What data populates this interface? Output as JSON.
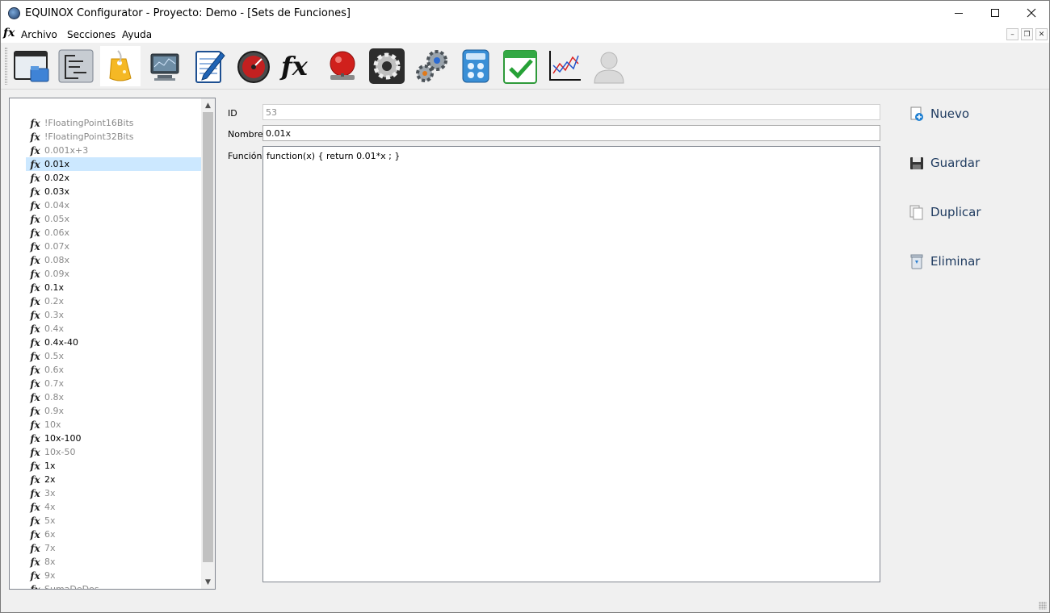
{
  "window": {
    "title": "EQUINOX Configurator - Proyecto: Demo - [Sets de Funciones]"
  },
  "menu": {
    "fx_symbol": "fx",
    "items": [
      "Archivo",
      "Secciones",
      "Ayuda"
    ]
  },
  "toolbar": {
    "buttons": [
      "window-folder-icon",
      "tree-list-icon",
      "price-tag-icon",
      "monitor-icon",
      "notepad-pen-icon",
      "gauge-icon",
      "fx-icon",
      "alarm-bell-icon",
      "settings-gear-icon",
      "gears-icon",
      "calculator-icon",
      "calendar-check-icon",
      "line-chart-icon",
      "user-icon"
    ]
  },
  "functions_list": {
    "selected": "0.01x",
    "items": [
      {
        "label": "!FloatingPoint16Bits",
        "active": false
      },
      {
        "label": "!FloatingPoint32Bits",
        "active": false
      },
      {
        "label": "0.001x+3",
        "active": false
      },
      {
        "label": "0.01x",
        "active": true
      },
      {
        "label": "0.02x",
        "active": true
      },
      {
        "label": "0.03x",
        "active": true
      },
      {
        "label": "0.04x",
        "active": false
      },
      {
        "label": "0.05x",
        "active": false
      },
      {
        "label": "0.06x",
        "active": false
      },
      {
        "label": "0.07x",
        "active": false
      },
      {
        "label": "0.08x",
        "active": false
      },
      {
        "label": "0.09x",
        "active": false
      },
      {
        "label": "0.1x",
        "active": true
      },
      {
        "label": "0.2x",
        "active": false
      },
      {
        "label": "0.3x",
        "active": false
      },
      {
        "label": "0.4x",
        "active": false
      },
      {
        "label": "0.4x-40",
        "active": true
      },
      {
        "label": "0.5x",
        "active": false
      },
      {
        "label": "0.6x",
        "active": false
      },
      {
        "label": "0.7x",
        "active": false
      },
      {
        "label": "0.8x",
        "active": false
      },
      {
        "label": "0.9x",
        "active": false
      },
      {
        "label": "10x",
        "active": false
      },
      {
        "label": "10x-100",
        "active": true
      },
      {
        "label": "10x-50",
        "active": false
      },
      {
        "label": "1x",
        "active": true
      },
      {
        "label": "2x",
        "active": true
      },
      {
        "label": "3x",
        "active": false
      },
      {
        "label": "4x",
        "active": false
      },
      {
        "label": "5x",
        "active": false
      },
      {
        "label": "6x",
        "active": false
      },
      {
        "label": "7x",
        "active": false
      },
      {
        "label": "8x",
        "active": false
      },
      {
        "label": "9x",
        "active": false
      },
      {
        "label": "SumaDeDos",
        "active": false
      }
    ]
  },
  "form": {
    "id_label": "ID",
    "id_value": "53",
    "name_label": "Nombre",
    "name_value": "0.01x",
    "function_label": "Función",
    "function_value": "function(x) { return 0.01*x ; }"
  },
  "actions": {
    "new": "Nuevo",
    "save": "Guardar",
    "duplicate": "Duplicar",
    "delete": "Eliminar"
  },
  "colors": {
    "selection": "#cce8ff",
    "action_text": "#1e3a5f"
  }
}
